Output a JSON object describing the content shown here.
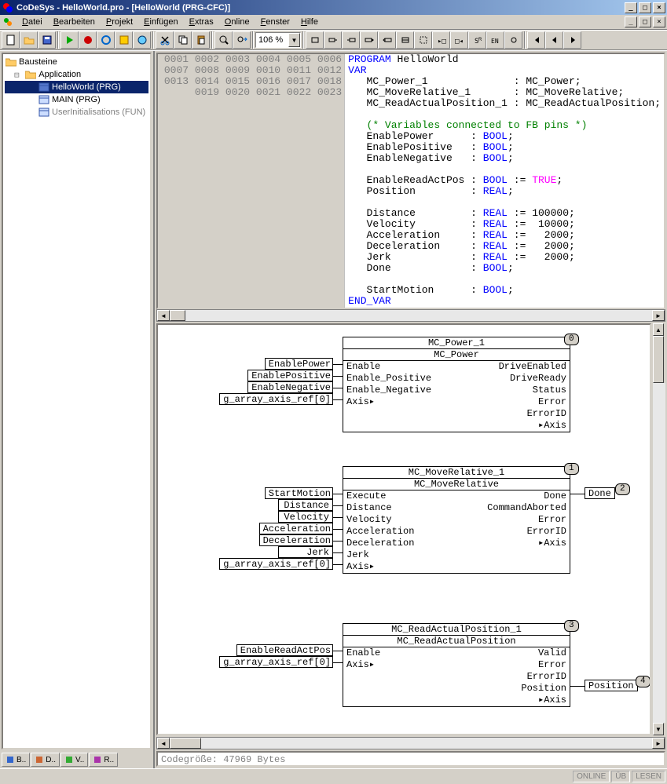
{
  "title": "CoDeSys - HelloWorld.pro - [HelloWorld (PRG-CFC)]",
  "menu": [
    "Datei",
    "Bearbeiten",
    "Projekt",
    "Einfügen",
    "Extras",
    "Online",
    "Fenster",
    "Hilfe"
  ],
  "zoom": "106 %",
  "tree": {
    "root": "Bausteine",
    "app": "Application",
    "items": [
      {
        "label": "HelloWorld (PRG)",
        "sel": true
      },
      {
        "label": "MAIN (PRG)",
        "sel": false
      },
      {
        "label": "UserInitialisations (FUN)",
        "sel": false,
        "dim": true
      }
    ]
  },
  "tabs": [
    "B..",
    "D..",
    "V..",
    "R.."
  ],
  "code": {
    "lines": [
      {
        "n": "0001",
        "seg": [
          [
            "kw",
            "PROGRAM"
          ],
          [
            "",
            " HelloWorld"
          ]
        ]
      },
      {
        "n": "0002",
        "seg": [
          [
            "kw",
            "VAR"
          ]
        ]
      },
      {
        "n": "0003",
        "seg": [
          [
            "",
            "   MC_Power_1              : MC_Power;"
          ]
        ]
      },
      {
        "n": "0004",
        "seg": [
          [
            "",
            "   MC_MoveRelative_1       : MC_MoveRelative;"
          ]
        ]
      },
      {
        "n": "0005",
        "seg": [
          [
            "",
            "   MC_ReadActualPosition_1 : MC_ReadActualPosition;"
          ]
        ]
      },
      {
        "n": "0006",
        "seg": [
          [
            "",
            ""
          ]
        ]
      },
      {
        "n": "0007",
        "seg": [
          [
            "",
            "   "
          ],
          [
            "cm",
            "(* Variables connected to FB pins *)"
          ]
        ]
      },
      {
        "n": "0008",
        "seg": [
          [
            "",
            "   EnablePower      : "
          ],
          [
            "kw",
            "BOOL"
          ],
          [
            "",
            ";"
          ]
        ]
      },
      {
        "n": "0009",
        "seg": [
          [
            "",
            "   EnablePositive   : "
          ],
          [
            "kw",
            "BOOL"
          ],
          [
            "",
            ";"
          ]
        ]
      },
      {
        "n": "0010",
        "seg": [
          [
            "",
            "   EnableNegative   : "
          ],
          [
            "kw",
            "BOOL"
          ],
          [
            "",
            ";"
          ]
        ]
      },
      {
        "n": "0011",
        "seg": [
          [
            "",
            ""
          ]
        ]
      },
      {
        "n": "0012",
        "seg": [
          [
            "",
            "   EnableReadActPos : "
          ],
          [
            "kw",
            "BOOL"
          ],
          [
            "",
            " := "
          ],
          [
            "vl",
            "TRUE"
          ],
          [
            "",
            ";"
          ]
        ]
      },
      {
        "n": "0013",
        "seg": [
          [
            "",
            "   Position         : "
          ],
          [
            "kw",
            "REAL"
          ],
          [
            "",
            ";"
          ]
        ]
      },
      {
        "n": "0014",
        "seg": [
          [
            "",
            ""
          ]
        ]
      },
      {
        "n": "0015",
        "seg": [
          [
            "",
            "   Distance         : "
          ],
          [
            "kw",
            "REAL"
          ],
          [
            "",
            " := 100000;"
          ]
        ]
      },
      {
        "n": "0016",
        "seg": [
          [
            "",
            "   Velocity         : "
          ],
          [
            "kw",
            "REAL"
          ],
          [
            "",
            " :=  10000;"
          ]
        ]
      },
      {
        "n": "0017",
        "seg": [
          [
            "",
            "   Acceleration     : "
          ],
          [
            "kw",
            "REAL"
          ],
          [
            "",
            " :=   2000;"
          ]
        ]
      },
      {
        "n": "0018",
        "seg": [
          [
            "",
            "   Deceleration     : "
          ],
          [
            "kw",
            "REAL"
          ],
          [
            "",
            " :=   2000;"
          ]
        ]
      },
      {
        "n": "0019",
        "seg": [
          [
            "",
            "   Jerk             : "
          ],
          [
            "kw",
            "REAL"
          ],
          [
            "",
            " :=   2000;"
          ]
        ]
      },
      {
        "n": "0020",
        "seg": [
          [
            "",
            "   Done             : "
          ],
          [
            "kw",
            "BOOL"
          ],
          [
            "",
            ";"
          ]
        ]
      },
      {
        "n": "0021",
        "seg": [
          [
            "",
            ""
          ]
        ]
      },
      {
        "n": "0022",
        "seg": [
          [
            "",
            "   StartMotion      : "
          ],
          [
            "kw",
            "BOOL"
          ],
          [
            "",
            ";"
          ]
        ]
      },
      {
        "n": "0023",
        "seg": [
          [
            "kw",
            "END_VAR"
          ]
        ]
      }
    ]
  },
  "fb1": {
    "name": "MC_Power_1",
    "type": "MC_Power",
    "badge": "0",
    "inputs": [
      "Enable",
      "Enable_Positive",
      "Enable_Negative",
      "Axis▸"
    ],
    "outputs": [
      "DriveEnabled",
      "DriveReady",
      "Status",
      "Error",
      "ErrorID",
      "▸Axis"
    ],
    "invals": [
      "EnablePower",
      "EnablePositive",
      "EnableNegative",
      "g_array_axis_ref[0]"
    ]
  },
  "fb2": {
    "name": "MC_MoveRelative_1",
    "type": "MC_MoveRelative",
    "badge": "1",
    "inputs": [
      "Execute",
      "Distance",
      "Velocity",
      "Acceleration",
      "Deceleration",
      "Jerk",
      "Axis▸"
    ],
    "outputs": [
      "Done",
      "CommandAborted",
      "Error",
      "ErrorID",
      "▸Axis"
    ],
    "invals": [
      "StartMotion",
      "Distance",
      "Velocity",
      "Acceleration",
      "Deceleration",
      "Jerk",
      "g_array_axis_ref[0]"
    ],
    "out": {
      "label": "Done",
      "badge": "2"
    }
  },
  "fb3": {
    "name": "MC_ReadActualPosition_1",
    "type": "MC_ReadActualPosition",
    "badge": "3",
    "inputs": [
      "Enable",
      "Axis▸"
    ],
    "outputs": [
      "Valid",
      "Error",
      "ErrorID",
      "Position",
      "▸Axis"
    ],
    "invals": [
      "EnableReadActPos",
      "g_array_axis_ref[0]"
    ],
    "out": {
      "label": "Position",
      "badge": "4"
    }
  },
  "msg": "Codegröße: 47969 Bytes",
  "status": [
    "ONLINE",
    "ÜB",
    "LESEN"
  ]
}
